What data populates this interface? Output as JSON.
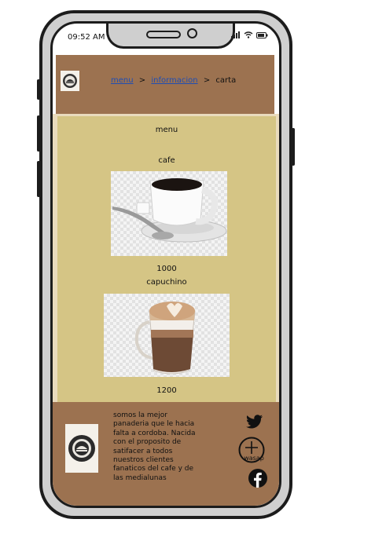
{
  "status_bar": {
    "time": "09:52 AM"
  },
  "breadcrumb": {
    "items": [
      "menu",
      "informacion"
    ],
    "current": "carta",
    "separator": ">"
  },
  "menu": {
    "title": "menu",
    "products": [
      {
        "name": "cafe",
        "price": "1000"
      },
      {
        "name": "capuchino",
        "price": "1200"
      }
    ]
  },
  "footer": {
    "about": "somos la mejor panaderia que le hacia falta a cordoba. Nacida con el proposito de satifacer a todos nuestros clientes fanaticos del cafe y de las medialunas",
    "wasap_label": "wasap"
  },
  "icons": {
    "logo": "bakery-logo-icon",
    "twitter": "twitter-icon",
    "whatsapp": "add-icon",
    "facebook": "facebook-icon",
    "signal": "signal-icon",
    "wifi": "wifi-icon",
    "battery": "battery-icon"
  },
  "colors": {
    "header": "#9c7250",
    "menu_bg": "#d5c585",
    "link": "#1f4db3"
  }
}
